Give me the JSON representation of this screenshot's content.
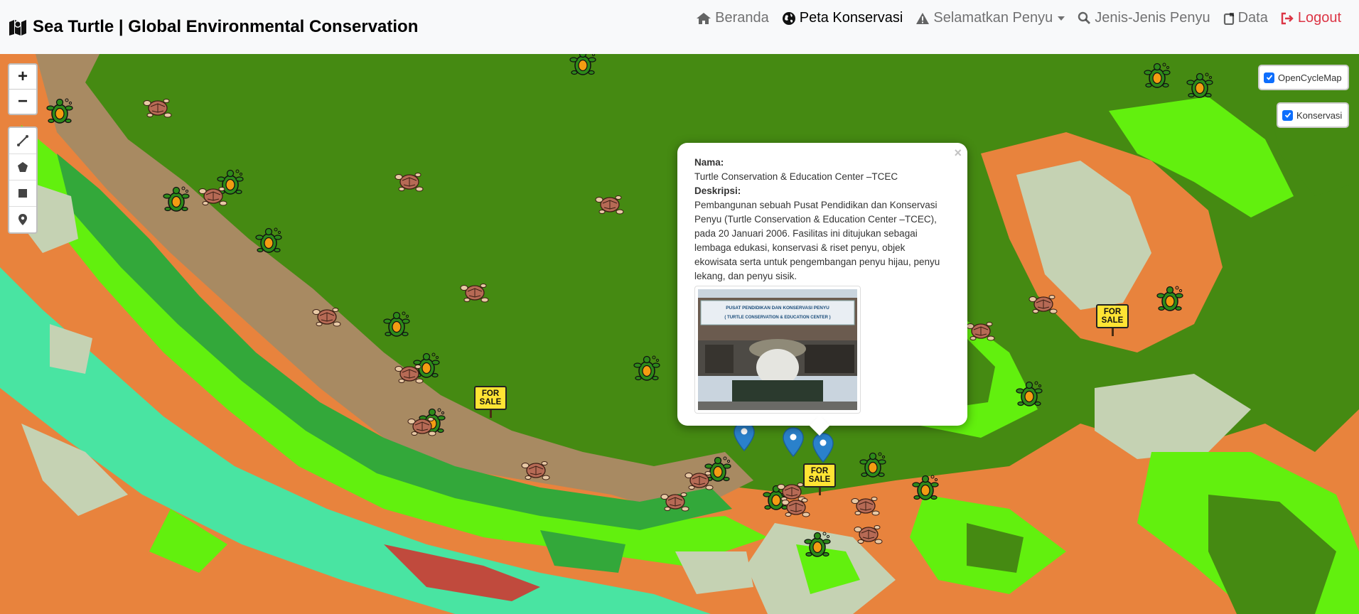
{
  "navbar": {
    "brand": "Sea Turtle | Global Environmental Conservation",
    "items": [
      {
        "label": "Beranda",
        "icon": "home-icon",
        "active": false
      },
      {
        "label": "Peta Konservasi",
        "icon": "globe-icon",
        "active": true
      },
      {
        "label": "Selamatkan Penyu",
        "icon": "warning-icon",
        "active": false
      },
      {
        "label": "Jenis-Jenis Penyu",
        "icon": "search-icon",
        "active": false
      },
      {
        "label": "Data",
        "icon": "database-icon",
        "active": false
      },
      {
        "label": "Logout",
        "icon": "logout-icon",
        "active": false
      }
    ]
  },
  "map_controls": {
    "zoom_in": "+",
    "zoom_out": "−",
    "draw_tools": [
      "draw-polyline-icon",
      "draw-polygon-icon",
      "draw-rectangle-icon",
      "draw-marker-icon"
    ]
  },
  "layers": {
    "base": "OpenCycleMap",
    "overlay": "Konservasi"
  },
  "popup": {
    "name_label": "Nama:",
    "name_value": "Turtle Conservation & Education Center –TCEC",
    "desc_label": "Deskripsi:",
    "desc_value": "Pembangunan sebuah Pusat Pendidikan dan Konservasi Penyu (Turtle Conservation & Education Center –TCEC), pada 20 Januari 2006. Fasilitas ini ditujukan sebagai lembaga edukasi, konservasi & riset penyu, objek ekowisata serta untuk pengembangan penyu hijau, penyu lekang, dan penyu sisik.",
    "photo_sign_line1": "PUSAT PENDIDIKAN DAN KONSERVASI PENYU",
    "photo_sign_line2": "( TURTLE CONSERVATION & EDUCATION CENTER )",
    "close": "×"
  },
  "sale_signs": {
    "line1": "FOR",
    "line2": "SALE"
  },
  "colors": {
    "ocean": "#e8833d",
    "land_dark": "#458a12",
    "land_bright": "#62f00e",
    "sand": "#a88a62",
    "pale": "#c5d2b3",
    "mint": "#49e4a2",
    "link_active": "#000000",
    "logout": "#dc3545"
  }
}
